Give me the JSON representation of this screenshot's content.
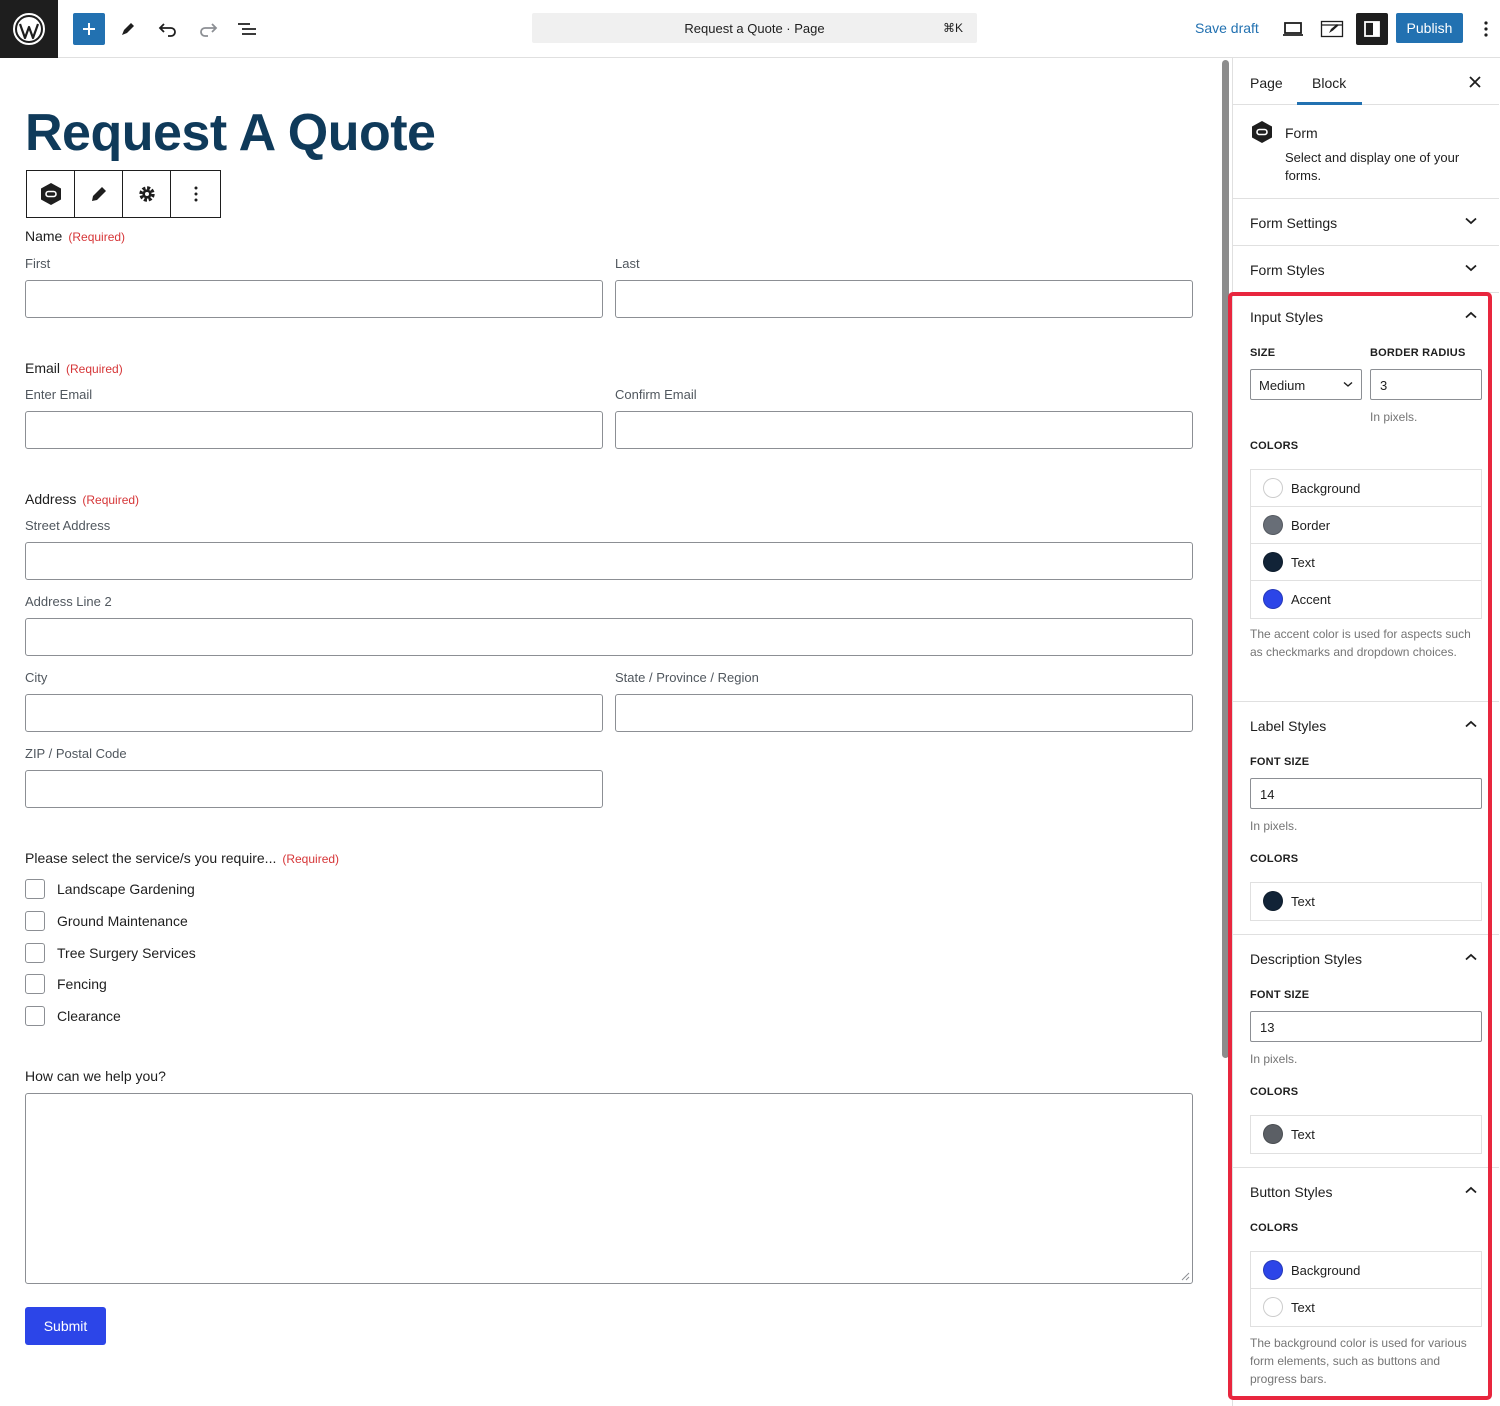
{
  "topbar": {
    "document_title": "Request a Quote · Page",
    "shortcut": "⌘K",
    "save_draft": "Save draft",
    "publish": "Publish",
    "icons": [
      "wordpress-logo-icon",
      "plus-icon",
      "pencil-icon",
      "undo-icon",
      "redo-icon",
      "list-view-icon",
      "desktop-view-icon",
      "external-edit-icon",
      "sidebar-toggle-icon",
      "more-vertical-icon"
    ]
  },
  "page": {
    "title": "Request A Quote"
  },
  "form": {
    "required_marker": "(Required)",
    "name": {
      "label": "Name",
      "first": "First",
      "last": "Last"
    },
    "email": {
      "label": "Email",
      "enter": "Enter Email",
      "confirm": "Confirm Email"
    },
    "address": {
      "label": "Address",
      "street": "Street Address",
      "line2": "Address Line 2",
      "city": "City",
      "state": "State / Province / Region",
      "zip": "ZIP / Postal Code"
    },
    "services": {
      "label": "Please select the service/s you require...",
      "options": [
        "Landscape Gardening",
        "Ground Maintenance",
        "Tree Surgery Services",
        "Fencing",
        "Clearance"
      ]
    },
    "help": {
      "label": "How can we help you?"
    },
    "submit": "Submit"
  },
  "sidebar": {
    "tabs": {
      "page": "Page",
      "block": "Block"
    },
    "block": {
      "title": "Form",
      "description": "Select and display one of your forms."
    },
    "form_settings": "Form Settings",
    "form_styles": "Form Styles",
    "input_styles": {
      "title": "Input Styles",
      "size_label": "SIZE",
      "size_value": "Medium",
      "radius_label": "BORDER RADIUS",
      "radius_value": "3",
      "radius_help": "In pixels.",
      "colors_label": "COLORS",
      "colors": [
        {
          "name": "Background",
          "color": "#ffffff"
        },
        {
          "name": "Border",
          "color": "#686e77"
        },
        {
          "name": "Text",
          "color": "#112337"
        },
        {
          "name": "Accent",
          "color": "#2c45e8"
        }
      ],
      "help": "The accent color is used for aspects such as checkmarks and dropdown choices."
    },
    "label_styles": {
      "title": "Label Styles",
      "font_size_label": "FONT SIZE",
      "font_size_value": "14",
      "font_help": "In pixels.",
      "colors_label": "COLORS",
      "colors": [
        {
          "name": "Text",
          "color": "#112337"
        }
      ]
    },
    "description_styles": {
      "title": "Description Styles",
      "font_size_label": "FONT SIZE",
      "font_size_value": "13",
      "font_help": "In pixels.",
      "colors_label": "COLORS",
      "colors": [
        {
          "name": "Text",
          "color": "#5b5f65"
        }
      ]
    },
    "button_styles": {
      "title": "Button Styles",
      "colors_label": "COLORS",
      "colors": [
        {
          "name": "Background",
          "color": "#2c45e8"
        },
        {
          "name": "Text",
          "color": "#ffffff"
        }
      ],
      "help": "The background color is used for various form elements, such as buttons and progress bars."
    },
    "highlight_color": "#e8263e"
  }
}
